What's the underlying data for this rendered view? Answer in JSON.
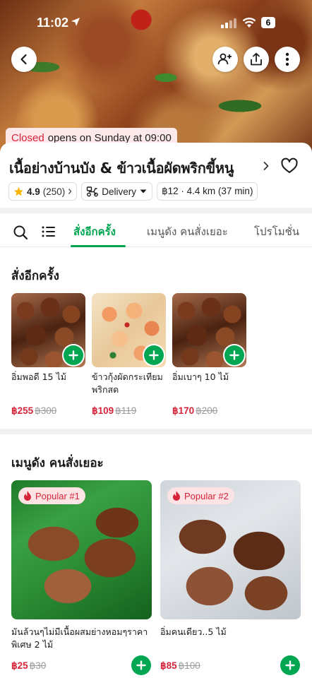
{
  "status_bar": {
    "time": "11:02",
    "battery": "6"
  },
  "header": {
    "back_icon": "chevron-left-icon",
    "invite_icon": "add-user-icon",
    "share_icon": "share-icon",
    "more_icon": "more-vertical-icon"
  },
  "store": {
    "status_word": "Closed",
    "status_rest": "opens on Sunday at 09:00",
    "name": "เนื้อย่างบ้านบัง & ข้าวเนื้อผัดพริกขี้หนู",
    "rating": "4.9",
    "rating_count": "(250)",
    "delivery_label": "Delivery",
    "delivery_info": "฿12 · 4.4 km (37 min)"
  },
  "tabs": [
    "สั่งอีกครั้ง",
    "เมนูดัง คนสั่งเยอะ",
    "โปรโมชั่น"
  ],
  "reorder": {
    "title": "สั่งอีกครั้ง",
    "items": [
      {
        "name": "อิ่มพอดี 15 ไม้",
        "price": "฿255",
        "old_price": "฿300"
      },
      {
        "name": "ข้าวกุ้งผัดกระเทียมพริกสด",
        "price": "฿109",
        "old_price": "฿119"
      },
      {
        "name": "อิ่มเบาๆ 10 ไม้",
        "price": "฿170",
        "old_price": "฿200"
      }
    ]
  },
  "popular": {
    "title": "เมนูดัง คนสั่งเยอะ",
    "items": [
      {
        "badge": "Popular #1",
        "name": "มันล้วนๆไม่มีเนื้อผสมย่างหอมๆราคาพิเศษ 2 ไม้",
        "price": "฿25",
        "old_price": "฿30"
      },
      {
        "badge": "Popular #2",
        "name": "อิ่มคนเดียว..5 ไม้",
        "price": "฿85",
        "old_price": "฿100"
      }
    ]
  },
  "colors": {
    "accent": "#00a651",
    "price_red": "#d5243a",
    "closed_bg": "#fde8ea"
  }
}
